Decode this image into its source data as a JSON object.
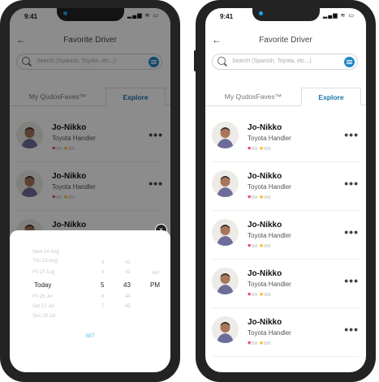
{
  "status": {
    "time": "9:41",
    "icons": "▂▄▆ ≋ ▭"
  },
  "header": {
    "back": "←",
    "title": "Favorite Driver"
  },
  "search": {
    "placeholder": "Search (Spanish, Toyota, etc...)"
  },
  "tabs": {
    "faves": "My QudosFaves™",
    "explore": "Explore"
  },
  "drivers": [
    {
      "name": "Jo-Nikko",
      "role": "Toyota Handler",
      "hearts": "888",
      "stars": "888"
    },
    {
      "name": "Jo-Nikko",
      "role": "Toyota Handler",
      "hearts": "888",
      "stars": "888"
    },
    {
      "name": "Jo-Nikko",
      "role": "Toyota Handler",
      "hearts": "888",
      "stars": "888"
    },
    {
      "name": "Jo-Nikko",
      "role": "Toyota Handler",
      "hearts": "888",
      "stars": "888"
    },
    {
      "name": "Jo-Nikko",
      "role": "Toyota Handler",
      "hearts": "888",
      "stars": "888"
    }
  ],
  "more": "•••",
  "picker": {
    "close": "×",
    "dates": [
      "Wed 24 Aug",
      "Thu 23 Aug",
      "Fri 27 Aug",
      "Today",
      "Fri 26 Jul",
      "Sat 27 Jul",
      "Sun 28 Jul"
    ],
    "hours": [
      "3",
      "4",
      "5",
      "6",
      "7"
    ],
    "minutes": [
      "41",
      "42",
      "43",
      "44",
      "45"
    ],
    "ampm": [
      "AM",
      "PM"
    ],
    "selected": {
      "date": "Today",
      "hour": "5",
      "minute": "43",
      "ampm": "PM"
    },
    "set_label": "SET"
  },
  "colors": {
    "accent": "#1b75ad",
    "heart": "#e0245e",
    "star": "#f5b301",
    "set": "#5ab4e8"
  }
}
